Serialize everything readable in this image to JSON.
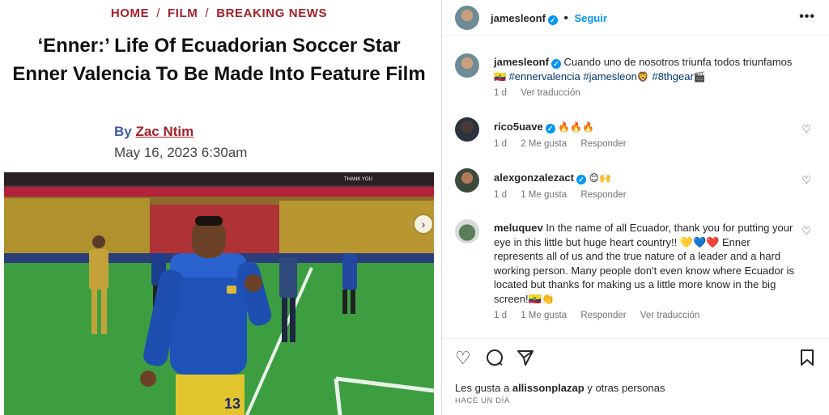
{
  "article": {
    "breadcrumbs": [
      "HOME",
      "FILM",
      "BREAKING NEWS"
    ],
    "headline": "‘Enner:’ Life Of Ecuadorian Soccer Star Enner Valencia To Be Made Into Feature Film",
    "byline_prefix": "By",
    "author": "Zac Ntim",
    "date": "May 16, 2023 6:30am",
    "photo": {
      "banner_text": "THANK YOU",
      "shorts_number": "13",
      "next_icon": "chevron-right-icon"
    }
  },
  "instagram": {
    "header": {
      "username": "jamesleonf",
      "follow_label": "Seguir",
      "more_icon": "more-horizontal-icon"
    },
    "caption": {
      "username": "jamesleonf",
      "text": "Cuando uno de nosotros triunfa todos triunfamos",
      "flag": "🇪🇨",
      "tag1": "#ennervalencia",
      "tag2": "#jamesleon",
      "emoji1": "🦁",
      "tag3": "#8thgear",
      "emoji2": "🎬",
      "time": "1 d",
      "translate": "Ver traducción"
    },
    "comments": [
      {
        "username": "rico5uave",
        "text": "🔥🔥🔥",
        "time": "1 d",
        "likes": "2 Me gusta",
        "reply": "Responder"
      },
      {
        "username": "alexgonzalezact",
        "text": "😊🙌",
        "time": "1 d",
        "likes": "1 Me gusta",
        "reply": "Responder"
      },
      {
        "username": "meluquev",
        "text": "In the name of all Ecuador, thank you for putting your eye in this little but huge heart country!! 💛💙❤️ Enner represents all of us and the true nature of a leader and a hard working person. Many people don't even know where Ecuador is located but thanks for making us a little more know in the big screen!🇪🇨👏",
        "time": "1 d",
        "likes": "1 Me gusta",
        "reply": "Responder",
        "translate": "Ver traducción"
      }
    ],
    "footer": {
      "likes_prefix": "Les gusta a",
      "liked_by": "allissonplazap",
      "likes_suffix": "y otras personas",
      "posted_ago": "HACE UN DÍA"
    }
  },
  "colors": {
    "brand_red": "#a4202b",
    "link_blue": "#0095f6",
    "hashtag_blue": "#00376b",
    "muted_gray": "#737373"
  }
}
